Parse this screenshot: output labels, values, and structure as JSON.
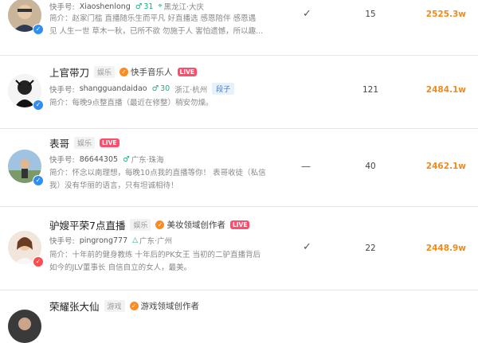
{
  "accent_color": "#f08a1c",
  "rows": [
    {
      "name": "",
      "account_label": "快手号:",
      "account_id": "Xiaoshenlong",
      "age": "31",
      "location": "黑龙江·大庆",
      "bio": [
        "简介：赵家门槛 直播随乐生而平凡 好直播选 感恩陪伴 感恩遇",
        "见 人生一世 草木一秋，已所不欲 勿施于人 害怕遗憾，所以趣..."
      ],
      "verified": true,
      "count": "15",
      "fans": "2525.3w"
    },
    {
      "name": "上官带刀",
      "category": "娱乐",
      "cert": "快手音乐人",
      "live": "LIVE",
      "account_label": "快手号:",
      "account_id": "shangguandaidao",
      "age": "30",
      "location": "浙江·杭州",
      "tag": "段子",
      "bio": [
        "简介：每晚9点整直播（最近在修整）稍安勿燥。"
      ],
      "verified": true,
      "count": "121",
      "fans": "2484.1w"
    },
    {
      "name": "表哥",
      "category": "娱乐",
      "live": "LIVE",
      "account_label": "快手号:",
      "account_id": "86644305",
      "location": "广东·珠海",
      "bio": [
        "简介：怀念以南理想，每晚10点我的直播等你！ 表哥收徒（私信",
        "我）没有华丽的语言，只有坦诚相待！"
      ],
      "verified": false,
      "count": "40",
      "fans": "2462.1w"
    },
    {
      "name": "驴嫂平荣7点直播",
      "category": "娱乐",
      "cert": "美妆领域创作者",
      "live": "LIVE",
      "account_label": "快手号:",
      "account_id": "pingrong777",
      "location": "广东·广州",
      "bio": [
        "简介：十年前的健身教练 十年后的PK女王 当初的二驴直播背后",
        "如今的JLV董事长 自信自立的女人，最美。"
      ],
      "verified": true,
      "count": "22",
      "fans": "2448.9w"
    },
    {
      "name": "荣耀张大仙",
      "category": "游戏",
      "cert": "游戏领域创作者"
    }
  ]
}
